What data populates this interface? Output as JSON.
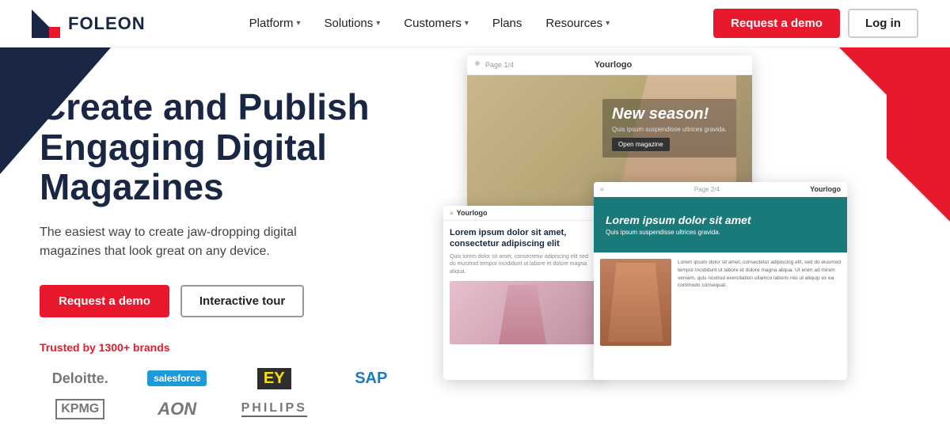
{
  "nav": {
    "logo_text": "FOLEON",
    "links": [
      {
        "label": "Platform",
        "has_dropdown": true
      },
      {
        "label": "Solutions",
        "has_dropdown": true
      },
      {
        "label": "Customers",
        "has_dropdown": true
      },
      {
        "label": "Plans",
        "has_dropdown": false
      },
      {
        "label": "Resources",
        "has_dropdown": true
      }
    ],
    "cta_demo": "Request a demo",
    "cta_login": "Log in"
  },
  "hero": {
    "title": "Create and Publish Engaging Digital Magazines",
    "subtitle": "The easiest way to create jaw-dropping digital magazines that look great on any device.",
    "btn_demo": "Request a demo",
    "btn_tour": "Interactive tour",
    "trusted": "Trusted by 1300+ brands",
    "brands": [
      {
        "name": "Deloitte.",
        "class": "deloitte"
      },
      {
        "name": "salesforce",
        "class": "salesforce"
      },
      {
        "name": "EY",
        "class": "ey"
      },
      {
        "name": "SAP",
        "class": "sap"
      },
      {
        "name": "KPMG",
        "class": "kpmg"
      },
      {
        "name": "AON",
        "class": "aon"
      },
      {
        "name": "PHILIPS",
        "class": "philips"
      }
    ]
  },
  "magazine_main": {
    "page_info": "Page 1/4",
    "logo": "Yourlogo",
    "overlay_title": "New season!",
    "overlay_sub": "Quis ipsum suspendisse ultrices gravida.",
    "overlay_btn": "Open magazine"
  },
  "magazine_small_left": {
    "logo": "Yourlogo",
    "title": "Lorem ipsum dolor sit amet, consectetur adipiscing elit",
    "text": "Quis lorem dolor sit amet, consectetur adipiscing elit sed do eiusmod tempor incididunt ut labore et dolore magna aliqua."
  },
  "magazine_small_right": {
    "logo": "Yourlogo",
    "page_info": "Page 2/4",
    "banner_title": "Lorem ipsum dolor sit amet",
    "banner_sub": "Quis ipsum suspendisse ultrices gravida.",
    "body_text": "Lorem ipsum dolor sit amet, consectetur adipiscing elit, sed do eiusmod tempor incididunt ut labore et dolore magna aliqua. Ut enim ad minim veniam, quis nostrud exercitation ullamco laboris nisi ut aliquip ex ea commodo consequat."
  },
  "colors": {
    "brand_dark": "#1a2744",
    "brand_red": "#e8192c",
    "teal": "#1a7a7a"
  }
}
